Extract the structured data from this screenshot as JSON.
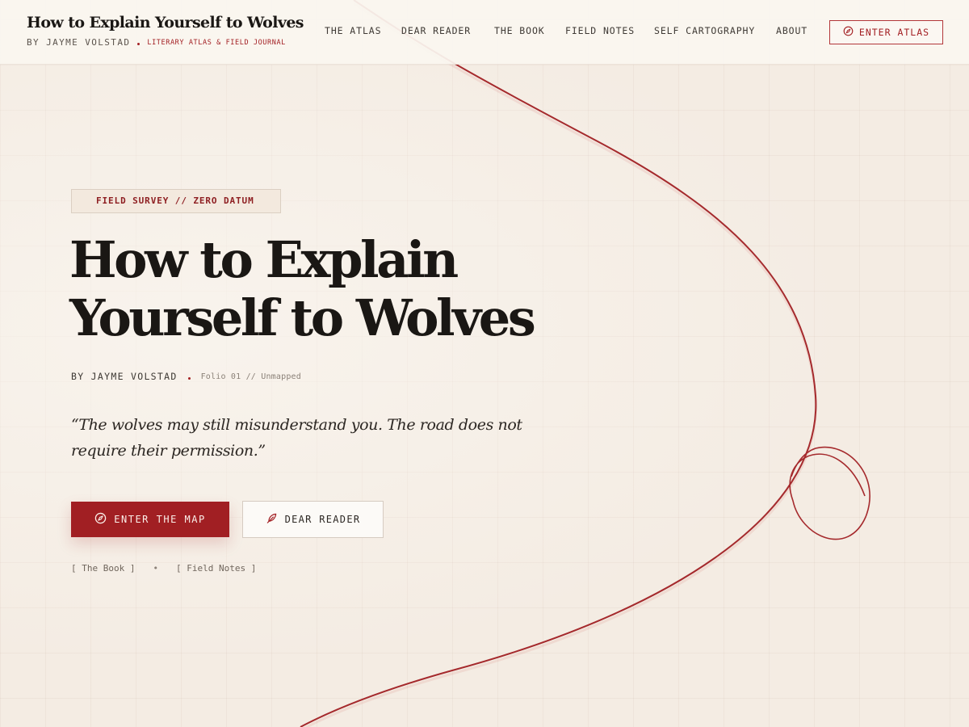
{
  "brand": {
    "title": "How to Explain Yourself to Wolves",
    "author": "BY JAYME VOLSTAD",
    "tagline": "LITERARY ATLAS & FIELD JOURNAL"
  },
  "nav": {
    "items": [
      {
        "label": "THE ATLAS"
      },
      {
        "label": "DEAR READER"
      },
      {
        "label": "THE BOOK"
      },
      {
        "label": "FIELD NOTES"
      },
      {
        "label": "SELF CARTOGRAPHY"
      },
      {
        "label": "ABOUT"
      }
    ],
    "cta": {
      "label": "ENTER ATLAS",
      "icon": "compass-icon"
    }
  },
  "hero": {
    "badge": "FIELD SURVEY // ZERO DATUM",
    "title_line1": "How to Explain",
    "title_line2": "Yourself to Wolves",
    "author": "BY JAYME VOLSTAD",
    "folio": "Folio 01 // Unmapped",
    "quote": "“The wolves may still misunderstand you. The road does not require their permission.”",
    "primary_button": {
      "label": "ENTER THE MAP",
      "icon": "compass-icon"
    },
    "secondary_button": {
      "label": "DEAR READER",
      "icon": "feather-icon"
    },
    "links": [
      {
        "label": "[ The Book ]"
      },
      {
        "label": "[ Field Notes ]"
      }
    ],
    "link_separator": "•"
  },
  "colors": {
    "accent": "#a11f23",
    "paper": "#f4ece3",
    "ink": "#1a1714",
    "route_line": "#a52a2d"
  }
}
